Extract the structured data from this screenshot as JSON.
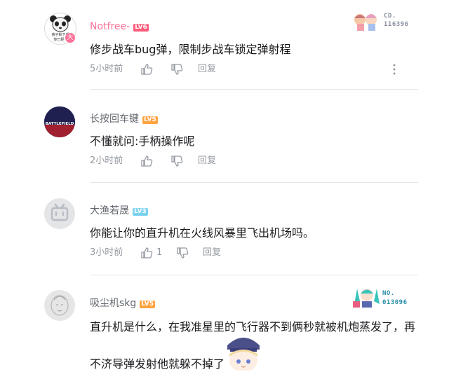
{
  "comments": [
    {
      "username": "Notfree-",
      "level": "LV6",
      "avatar_text": [
        "孩子就下手",
        "你已经",
        "大"
      ],
      "content": "修步战车bug弹，限制步战车锁定弹射程",
      "time": "5小时前",
      "likes": "",
      "reply_label": "回复",
      "badge": {
        "label": "CD.",
        "number": "116396"
      }
    },
    {
      "username": "长按回车键",
      "level": "LV5",
      "avatar_text": [
        "BATTLEFIELD"
      ],
      "content": "不懂就问:手柄操作呢",
      "time": "2小时前",
      "likes": "",
      "reply_label": "回复"
    },
    {
      "username": "大渔若晟",
      "level": "LV3",
      "content": "你能让你的直升机在火线风暴里飞出机场吗。",
      "time": "3小时前",
      "likes": "1",
      "reply_label": "回复"
    },
    {
      "username": "吸尘机skg",
      "level": "LV5",
      "content": "直升机是什么，在我准星里的飞行器不到俩秒就被机炮蒸发了，再",
      "content_line2": "不济导弹发射他就躲不掉了",
      "badge": {
        "label": "NO.",
        "number": "013096"
      }
    }
  ],
  "colors": {
    "vip_name": "#fb7299",
    "normal_name": "#61666d",
    "badge_text": "#4a5fa8",
    "badge_text2": "#2a8fa8"
  }
}
